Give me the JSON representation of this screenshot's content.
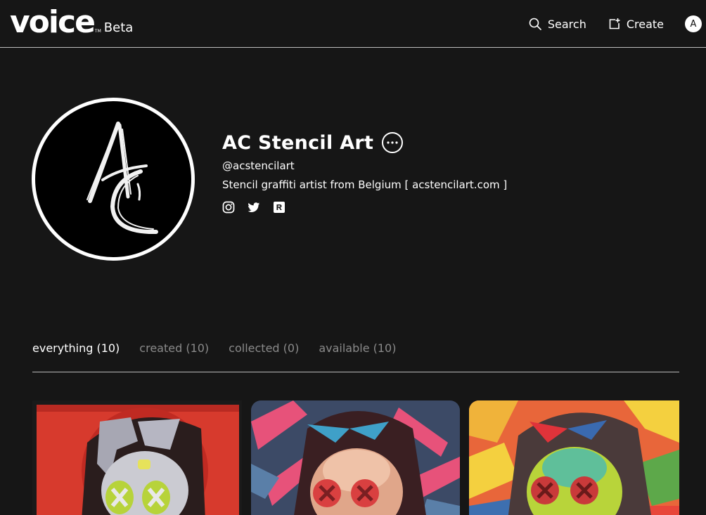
{
  "header": {
    "logo": "voice",
    "logo_tm": "TM",
    "badge": "Beta",
    "search_label": "Search",
    "create_label": "Create",
    "avatar_initial": "A"
  },
  "profile": {
    "name": "AC Stencil Art",
    "handle": "@acstencilart",
    "bio": "Stencil graffiti artist from Belgium [ acstencilart.com ]",
    "socials": [
      "instagram-icon",
      "twitter-icon",
      "rarible-icon"
    ]
  },
  "tabs": [
    {
      "label": "everything (10)",
      "active": true
    },
    {
      "label": "created (10)",
      "active": false
    },
    {
      "label": "collected (0)",
      "active": false
    },
    {
      "label": "available (10)",
      "active": false
    }
  ],
  "colors": {
    "background": "#161616",
    "text": "#ffffff",
    "muted": "#8a8a8a",
    "divider": "#bdbdbd"
  }
}
